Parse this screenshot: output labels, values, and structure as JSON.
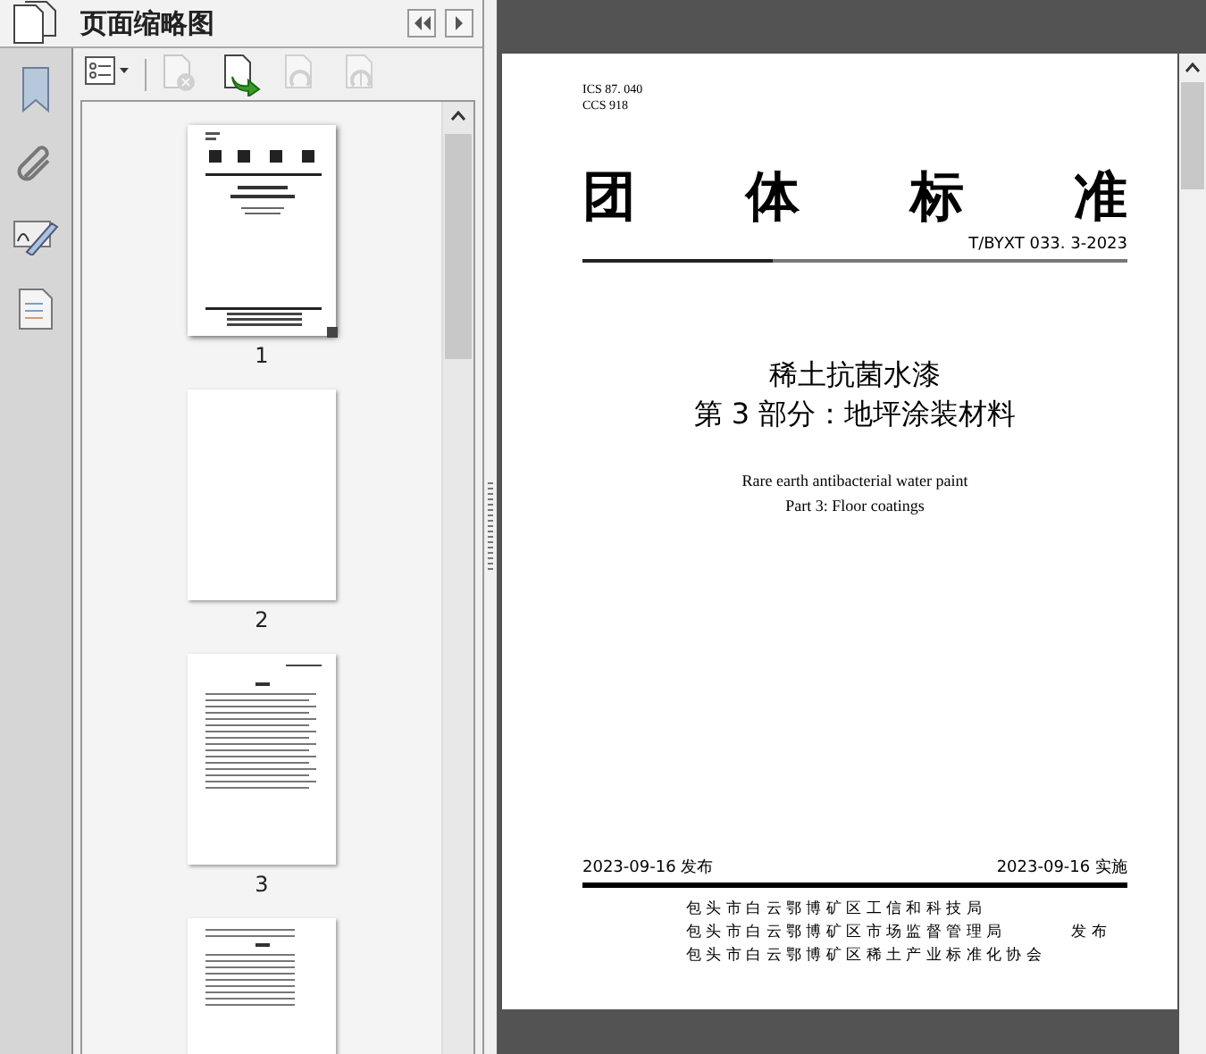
{
  "panel": {
    "title": "页面缩略图"
  },
  "toolbar": [
    {
      "kind": "options",
      "disabled": false
    },
    {
      "kind": "delete",
      "disabled": true
    },
    {
      "kind": "insert",
      "disabled": false
    },
    {
      "kind": "undo",
      "disabled": true
    },
    {
      "kind": "redo",
      "disabled": true
    }
  ],
  "thumbnails": [
    {
      "kind": "cover",
      "number": "1",
      "selected": true
    },
    {
      "kind": "blank",
      "number": "2",
      "selected": false
    },
    {
      "kind": "toc",
      "number": "3",
      "selected": false
    },
    {
      "kind": "text",
      "selected": false
    }
  ],
  "document": {
    "ics": "ICS 87. 040",
    "ccs": "CCS 918",
    "heading": [
      "团",
      "体",
      "标",
      "准"
    ],
    "code": "T/BYXT 033. 3-2023",
    "title_cn": [
      "稀土抗菌水漆",
      "第 3 部分：地坪涂装材料"
    ],
    "title_en": [
      "Rare earth antibacterial water paint",
      "Part 3: Floor coatings"
    ],
    "issue_date": "2023-09-16 发布",
    "effective_date": "2023-09-16 实施",
    "issuers": [
      "包头市白云鄂博矿区工信和科技局",
      "包头市白云鄂博矿区市场监督管理局",
      "包头市白云鄂博矿区稀土产业标准化协会"
    ],
    "issue_label": "发布"
  }
}
